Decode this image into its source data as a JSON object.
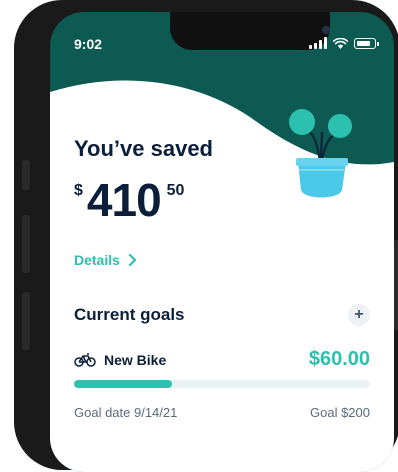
{
  "status": {
    "time": "9:02"
  },
  "savings": {
    "title": "You’ve saved",
    "currency": "$",
    "dollars": "410",
    "cents": "50",
    "details_label": "Details"
  },
  "goals": {
    "title": "Current goals",
    "add_label": "+",
    "items": [
      {
        "name": "New Bike",
        "icon": "bike-icon",
        "amount": "$60.00",
        "progress": 0.33,
        "goal_date": "Goal date 9/14/21",
        "goal_amount": "Goal $200"
      }
    ]
  },
  "colors": {
    "header_bg": "#0c5a52",
    "accent": "#2bc1ae",
    "text_dark": "#0b1f3a",
    "plant_leaf": "#2bc1ae",
    "plant_pot": "#4cc9e9"
  }
}
